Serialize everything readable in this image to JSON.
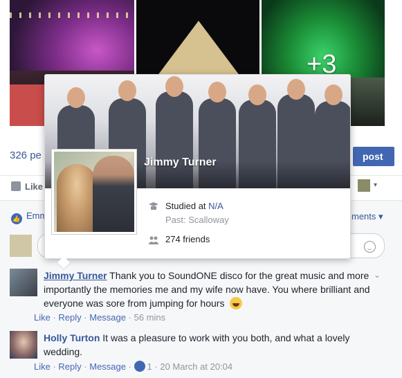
{
  "photos": {
    "more_count": "+3"
  },
  "post": {
    "views_text": "326 pe",
    "post_button": "post"
  },
  "actions": {
    "like_label": "Like"
  },
  "reactions": {
    "liker_text": "Emm",
    "more_comments": "ments"
  },
  "hovercard": {
    "name": "Jimmy Turner",
    "education_prefix": "Studied at ",
    "education_link": "N/A",
    "past": "Past: Scalloway",
    "friends": "274 friends"
  },
  "comments": [
    {
      "author": "Jimmy Turner",
      "text_1": " Thank you to SoundONE disco for the great music and more importantly the memories me and my wife now have. You where brilliant and everyone was sore from jumping for hours",
      "like": "Like",
      "reply": "Reply",
      "message": "Message",
      "time": "56 mins"
    },
    {
      "author": "Holly Turton",
      "text_1": " It was a pleasure to work with you both, and what a lovely wedding.",
      "like": "Like",
      "reply": "Reply",
      "message": "Message",
      "reaction_count": "1",
      "time": "20 March at 20:04"
    }
  ],
  "separators": {
    "dot": " · "
  }
}
